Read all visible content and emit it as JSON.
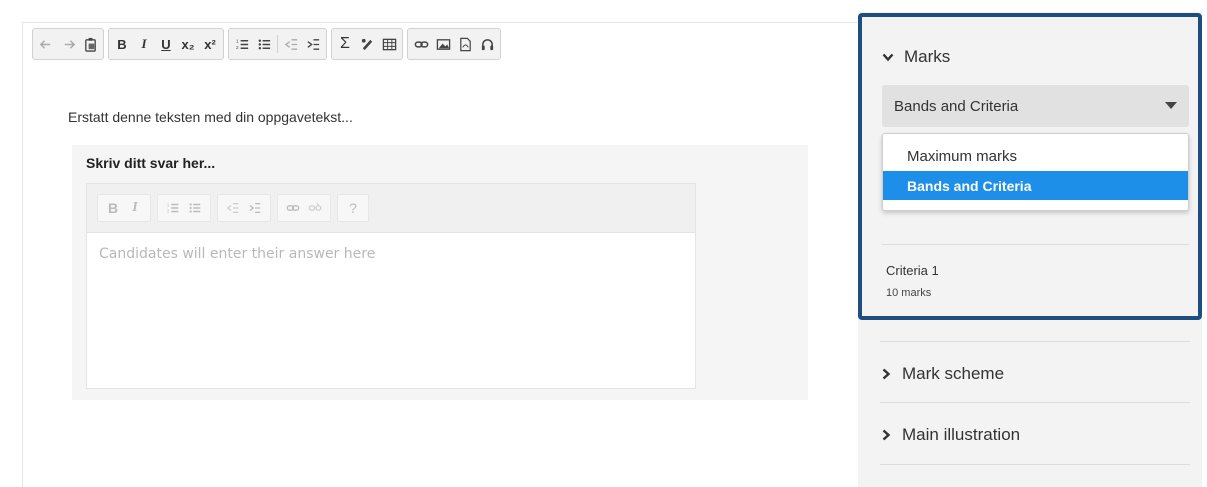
{
  "editor": {
    "prompt_text": "Erstatt denne teksten med din oppgavetekst...",
    "answer_heading": "Skriv ditt svar her...",
    "answer_placeholder": "Candidates will enter their answer here",
    "toolbar": {
      "bold": "B",
      "italic": "I",
      "underline": "U",
      "subscript": "x₂",
      "superscript": "x²",
      "sum": "Σ"
    },
    "answer_toolbar": {
      "bold": "B",
      "italic": "I",
      "help": "?"
    }
  },
  "side_panel": {
    "marks_section": {
      "title": "Marks",
      "expanded": true,
      "select_value": "Bands and Criteria",
      "options": [
        "Maximum marks",
        "Bands and Criteria"
      ],
      "selected_option": "Bands and Criteria",
      "criteria": {
        "name": "Criteria 1",
        "marks": "10 marks"
      }
    },
    "mark_scheme": {
      "title": "Mark scheme"
    },
    "main_illustration": {
      "title": "Main illustration"
    }
  },
  "colors": {
    "highlight_frame": "#1d4e7f",
    "selected_option_bg": "#1e8fe8"
  }
}
